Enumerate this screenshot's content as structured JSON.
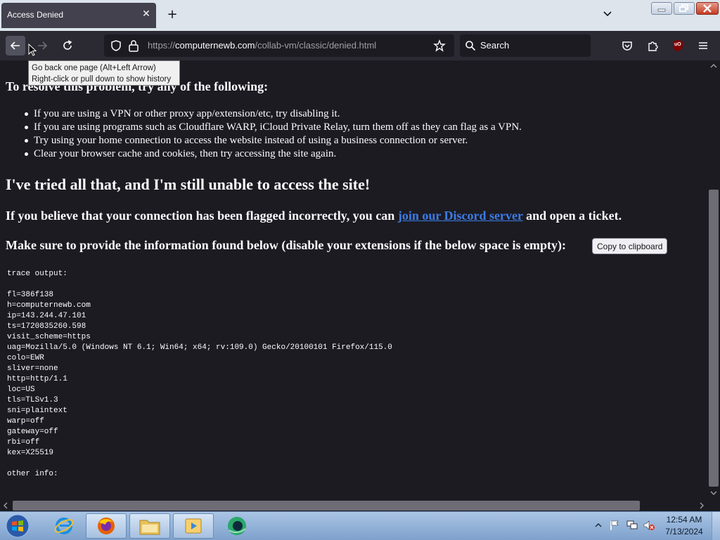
{
  "browser": {
    "tab_title": "Access Denied",
    "url_prefix": "https://",
    "url_host": "computernewb.com",
    "url_path": "/collab-vm/classic/denied.html",
    "search_placeholder": "Search",
    "ublock_badge": "uO"
  },
  "tooltip": {
    "line1": "Go back one page (Alt+Left Arrow)",
    "line2": "Right-click or pull down to show history"
  },
  "page": {
    "resolve_heading": "To resolve this problem, try any of the following:",
    "tips": [
      "If you are using a VPN or other proxy app/extension/etc, try disabling it.",
      "If you are using programs such as Cloudflare WARP, iCloud Private Relay, turn them off as they can flag as a VPN.",
      "Try using your home connection to access the website instead of using a business connection or server.",
      "Clear your browser cache and cookies, then try accessing the site again."
    ],
    "tried_heading": "I've tried all that, and I'm still unable to access the site!",
    "flagged_before": "If you believe that your connection has been flagged incorrectly, you can ",
    "discord_link": "join our Discord server",
    "flagged_after": " and open a ticket.",
    "provide_text": "Make sure to provide the information found below (disable your extensions if the below space is empty):",
    "copy_button": "Copy to clipboard",
    "trace_output": "trace output:\n\nfl=386f138\nh=computernewb.com\nip=143.244.47.101\nts=1720835260.598\nvisit_scheme=https\nuag=Mozilla/5.0 (Windows NT 6.1; Win64; x64; rv:109.0) Gecko/20100101 Firefox/115.0\ncolo=EWR\nsliver=none\nhttp=http/1.1\nloc=US\ntls=TLSv1.3\nsni=plaintext\nwarp=off\ngateway=off\nrbi=off\nkex=X25519\n\nother info:"
  },
  "taskbar": {
    "time": "12:54 AM",
    "date": "7/13/2024"
  },
  "colors": {
    "content_bg": "#1c1b22",
    "toolbar_bg": "#2b2a33",
    "link": "#3c7ce6",
    "text": "#fbfbfe"
  }
}
